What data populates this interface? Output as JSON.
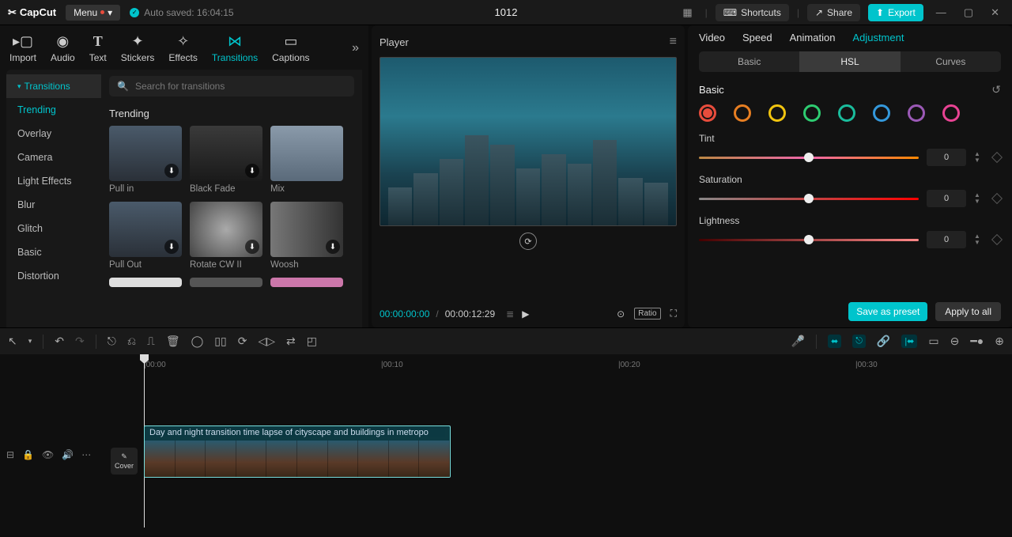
{
  "app": {
    "name": "CapCut",
    "menu": "Menu",
    "autosave": "Auto saved: 16:04:15",
    "project_title": "1012"
  },
  "topbar": {
    "shortcuts": "Shortcuts",
    "share": "Share",
    "export": "Export"
  },
  "nav": {
    "import": "Import",
    "audio": "Audio",
    "text": "Text",
    "stickers": "Stickers",
    "effects": "Effects",
    "transitions": "Transitions",
    "captions": "Captions"
  },
  "sidebar": {
    "head": "Transitions",
    "items": [
      "Trending",
      "Overlay",
      "Camera",
      "Light Effects",
      "Blur",
      "Glitch",
      "Basic",
      "Distortion"
    ]
  },
  "search": {
    "placeholder": "Search for transitions"
  },
  "section_trending": "Trending",
  "transitions": [
    {
      "name": "Pull in"
    },
    {
      "name": "Black Fade"
    },
    {
      "name": "Mix"
    },
    {
      "name": "Pull Out"
    },
    {
      "name": "Rotate CW II"
    },
    {
      "name": "Woosh"
    }
  ],
  "player": {
    "title": "Player",
    "tc_current": "00:00:00:00",
    "tc_duration": "00:00:12:29",
    "ratio": "Ratio"
  },
  "right": {
    "tabs": {
      "video": "Video",
      "speed": "Speed",
      "animation": "Animation",
      "adjustment": "Adjustment"
    },
    "subtabs": {
      "basic": "Basic",
      "hsl": "HSL",
      "curves": "Curves"
    },
    "section": "Basic",
    "sliders": {
      "tint": {
        "label": "Tint",
        "value": "0"
      },
      "saturation": {
        "label": "Saturation",
        "value": "0"
      },
      "lightness": {
        "label": "Lightness",
        "value": "0"
      }
    },
    "save_preset": "Save as preset",
    "apply_all": "Apply to all"
  },
  "hsl_colors": [
    "#e74c3c",
    "#e67e22",
    "#f1c40f",
    "#2ecc71",
    "#1abc9c",
    "#3498db",
    "#9b59b6",
    "#e84393"
  ],
  "timeline": {
    "marks": [
      "00:00",
      "00:10",
      "00:20",
      "00:30"
    ],
    "cover": "Cover",
    "clip_title": "Day and night transition time lapse of cityscape and buildings in metropo"
  }
}
